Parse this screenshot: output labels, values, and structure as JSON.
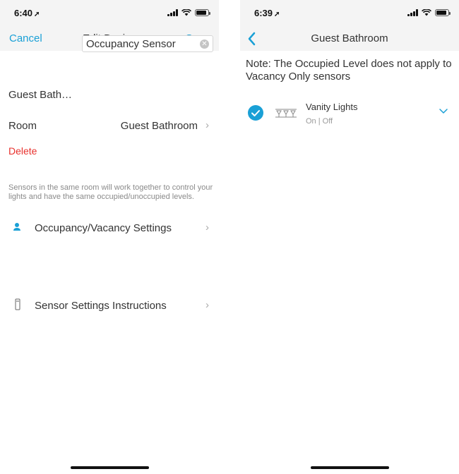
{
  "left": {
    "status": {
      "time": "6:40",
      "battery_level": 0.9
    },
    "nav": {
      "cancel_label": "Cancel",
      "title": "Edit Device",
      "save_label": "Save"
    },
    "name_row": {
      "label": "Guest Bath…",
      "value": "Occupancy Sensor"
    },
    "room_row": {
      "label": "Room",
      "value": "Guest Bathroom"
    },
    "delete_label": "Delete",
    "helper_text": "Sensors in the same room will work together to control your lights and have the same occupied/unoccupied levels.",
    "occupancy_row": {
      "label": "Occupancy/Vacancy Settings",
      "icon": "person-icon"
    },
    "instructions_row": {
      "label": "Sensor Settings Instructions",
      "icon": "sensor-device-icon"
    }
  },
  "right": {
    "status": {
      "time": "6:39",
      "battery_level": 0.9
    },
    "nav": {
      "title": "Guest Bathroom"
    },
    "note": "Note: The Occupied Level does not apply to Vacancy Only sensors",
    "light": {
      "name": "Vanity Lights",
      "status": "On | Off",
      "checked": true
    }
  },
  "colors": {
    "accent": "#1aa0d6",
    "delete": "#e8312d",
    "secondary_text": "#8a8a8a"
  }
}
